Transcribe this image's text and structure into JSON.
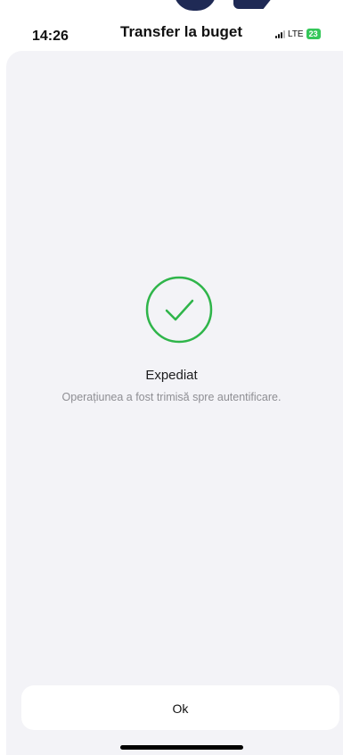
{
  "status_bar": {
    "time": "14:26",
    "network": "LTE",
    "battery": "23"
  },
  "header": {
    "title": "Transfer la buget"
  },
  "result": {
    "icon": "check-circle-icon",
    "title": "Expediat",
    "subtitle": "Operațiunea a fost trimisă spre autentificare.",
    "accent_color": "#2fb54a"
  },
  "actions": {
    "ok_label": "Ok"
  }
}
